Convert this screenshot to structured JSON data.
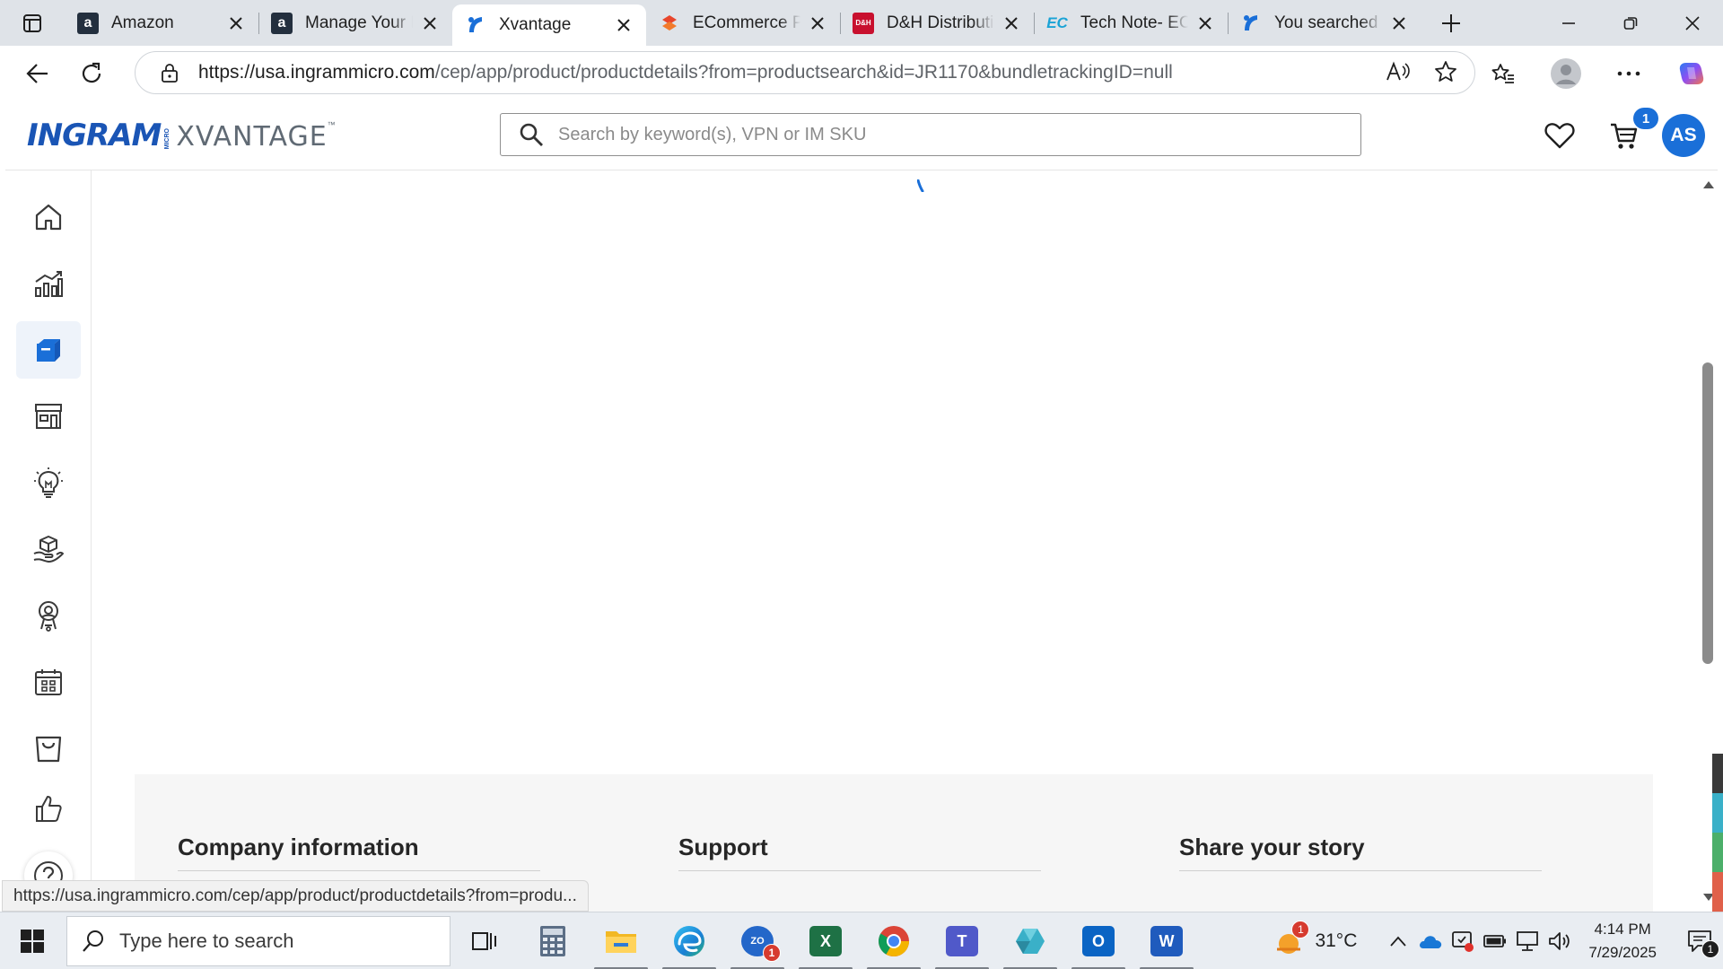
{
  "browser": {
    "tabs": [
      {
        "title": "Amazon",
        "favicon": "amazon-icon",
        "favicon_color": "#232f3e",
        "active": false
      },
      {
        "title": "Manage Your Inventory",
        "favicon": "amazon-icon",
        "favicon_color": "#232f3e",
        "active": false
      },
      {
        "title": "Xvantage",
        "favicon": "ingram-icon",
        "favicon_color": "#1a6fd8",
        "active": true
      },
      {
        "title": "ECommerce Product",
        "favicon": "ecommerce-icon",
        "favicon_color": "#e8462c",
        "active": false
      },
      {
        "title": "D&H Distributing",
        "favicon": "dh-icon",
        "favicon_color": "#c8102e",
        "active": false
      },
      {
        "title": "Tech Note- ECE",
        "favicon": "ec-icon",
        "favicon_color": "#1aa3d6",
        "active": false
      },
      {
        "title": "You searched for",
        "favicon": "ingram-icon",
        "favicon_color": "#1a6fd8",
        "active": false
      }
    ],
    "dh_favicon_text": "D&H",
    "ec_favicon_text": "EC",
    "url_host": "https://usa.ingrammicro.com",
    "url_path": "/cep/app/product/productdetails?from=productsearch&id=JR1170&bundletrackingID=null"
  },
  "site": {
    "logo_main": "INGRAM",
    "logo_micro": "MICRO",
    "logo_product": "XVANTAGE",
    "logo_tm": "™",
    "search_placeholder": "Search by keyword(s), VPN or IM SKU",
    "cart_count": "1",
    "avatar_initials": "AS",
    "accent_color": "#1a6fd8"
  },
  "sidenav": {
    "items": [
      {
        "icon": "home-icon",
        "active": false
      },
      {
        "icon": "analytics-icon",
        "active": false
      },
      {
        "icon": "products-icon",
        "active": true
      },
      {
        "icon": "store-icon",
        "active": false
      },
      {
        "icon": "lightbulb-icon",
        "active": false
      },
      {
        "icon": "services-icon",
        "active": false
      },
      {
        "icon": "support-icon",
        "active": false
      },
      {
        "icon": "calendar-icon",
        "active": false
      },
      {
        "icon": "shopping-bag-icon",
        "active": false
      },
      {
        "icon": "thumbs-up-icon",
        "active": false
      }
    ],
    "help_icon": "help-icon"
  },
  "footer": {
    "columns": [
      "Company information",
      "Support",
      "Share your story"
    ]
  },
  "status_link": "https://usa.ingrammicro.com/cep/app/product/productdetails?from=produ...",
  "taskbar": {
    "search_placeholder": "Type here to search",
    "apps": [
      "task-view-icon",
      "calculator-icon",
      "file-explorer-icon",
      "edge-icon",
      "zoho-icon",
      "excel-icon",
      "chrome-icon",
      "teams-icon",
      "app-icon",
      "outlook-icon",
      "word-icon"
    ],
    "zoho_label": "ZO",
    "zoho_badge": "1",
    "excel_label": "X",
    "teams_label": "T",
    "outlook_label": "O",
    "word_label": "W",
    "weather_badge": "1",
    "temperature": "31°C",
    "time": "4:14 PM",
    "date": "7/29/2025",
    "notification_count": "1"
  }
}
